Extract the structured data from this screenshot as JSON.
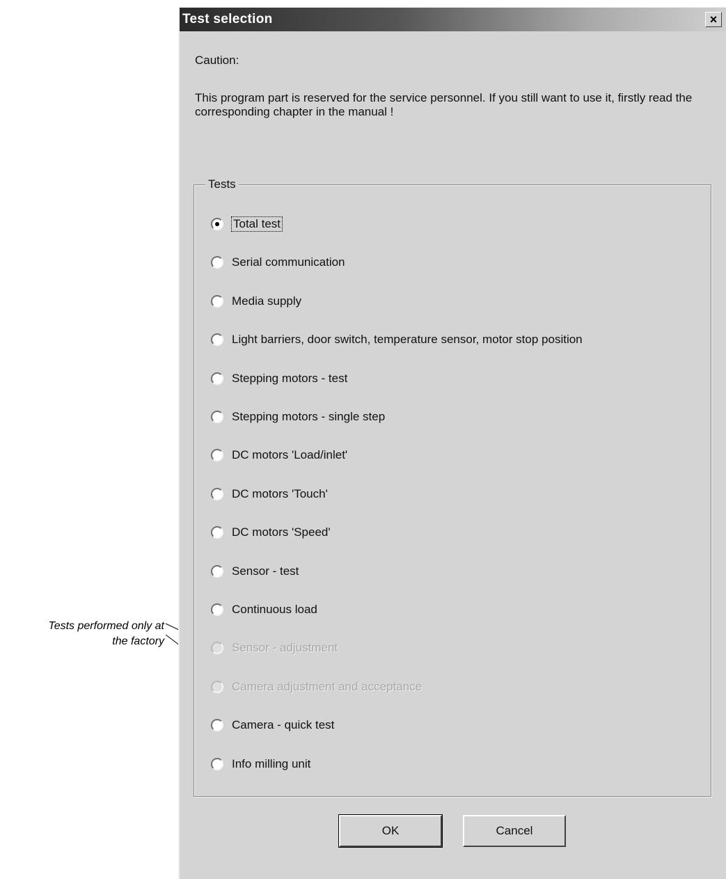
{
  "dialog": {
    "title": "Test selection",
    "close_glyph": "×",
    "caption": "Caution:",
    "warning": "This program part is reserved for the service personnel. If you still want to use it, firstly read the corresponding chapter in the manual !"
  },
  "tests": {
    "group_label": "Tests",
    "selected_index": 0,
    "options": [
      {
        "label": "Total test",
        "checked": true,
        "enabled": true
      },
      {
        "label": "Serial communication",
        "checked": false,
        "enabled": true
      },
      {
        "label": "Media supply",
        "checked": false,
        "enabled": true
      },
      {
        "label": "Light barriers, door switch, temperature sensor, motor stop position",
        "checked": false,
        "enabled": true
      },
      {
        "label": "Stepping motors - test",
        "checked": false,
        "enabled": true
      },
      {
        "label": "Stepping motors - single step",
        "checked": false,
        "enabled": true
      },
      {
        "label": "DC motors 'Load/inlet'",
        "checked": false,
        "enabled": true
      },
      {
        "label": "DC motors 'Touch'",
        "checked": false,
        "enabled": true
      },
      {
        "label": "DC motors 'Speed'",
        "checked": false,
        "enabled": true
      },
      {
        "label": "Sensor - test",
        "checked": false,
        "enabled": true
      },
      {
        "label": "Continuous load",
        "checked": false,
        "enabled": true
      },
      {
        "label": "Sensor - adjustment",
        "checked": false,
        "enabled": false
      },
      {
        "label": "Camera adjustment and acceptance",
        "checked": false,
        "enabled": false
      },
      {
        "label": "Camera - quick test",
        "checked": false,
        "enabled": true
      },
      {
        "label": "Info milling unit",
        "checked": false,
        "enabled": true
      }
    ]
  },
  "buttons": {
    "ok_label": "OK",
    "cancel_label": "Cancel"
  },
  "annotation": {
    "line1": "Tests performed only at",
    "line2": "the factory"
  }
}
